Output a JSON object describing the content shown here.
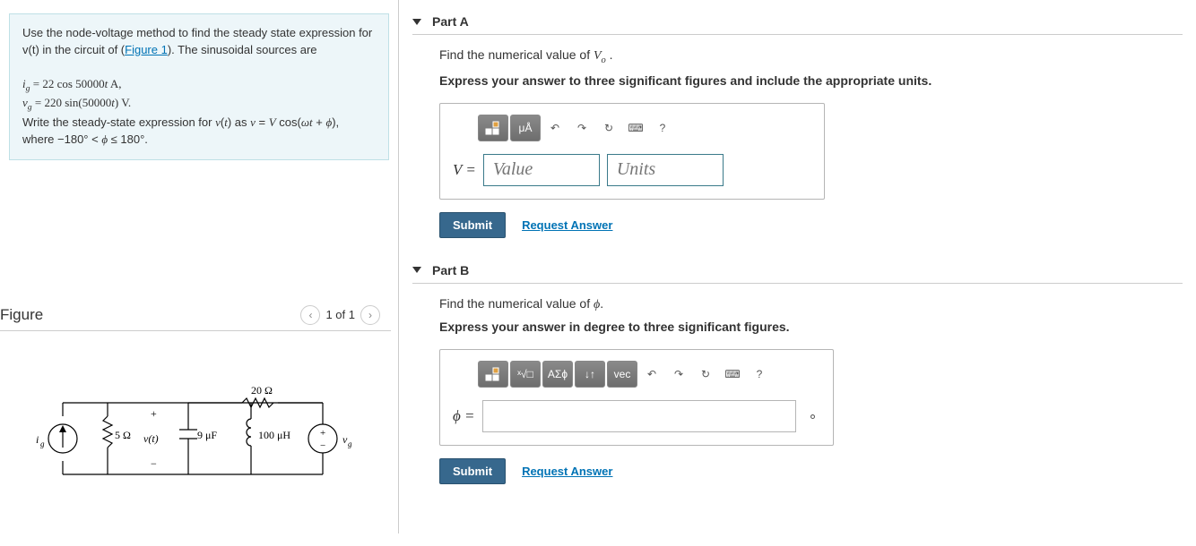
{
  "prompt": {
    "line1a": "Use the node-voltage method to find the steady state expression for v(t) in the circuit of (",
    "figure_link": "Figure 1",
    "line1b": "). The sinusoidal sources are",
    "eq_ig": "i_g = 22 cos 50000t A,",
    "eq_vg": "v_g = 220 sin(50000t) V.",
    "line4": "Write the steady-state expression for v(t) as v = V cos(ωt + ϕ),",
    "line5": "where −180° < ϕ ≤ 180°."
  },
  "figure": {
    "title": "Figure",
    "nav_text": "1 of 1",
    "labels": {
      "ig": "i_g",
      "r1": "5 Ω",
      "vt": "v(t)",
      "c": "9 μF",
      "r2": "20 Ω",
      "l": "100 μH",
      "vg": "v_g"
    }
  },
  "partA": {
    "name": "Part A",
    "instr": "Find the numerical value of V_o .",
    "hint": "Express your answer to three significant figures and include the appropriate units.",
    "toolbar": {
      "tmpl": "□",
      "units": "μÅ",
      "undo": "↶",
      "redo": "↷",
      "reset": "↻",
      "kbd": "⌨",
      "help": "?"
    },
    "varlabel": "V =",
    "value_ph": "Value",
    "units_ph": "Units",
    "submit": "Submit",
    "request": "Request Answer"
  },
  "partB": {
    "name": "Part B",
    "instr": "Find the numerical value of ϕ.",
    "hint": "Express your answer in degree to three significant figures.",
    "toolbar": {
      "tmpl": "□",
      "root": "ˣ√□",
      "greek": "ΑΣϕ",
      "arrows": "↓↑",
      "vec": "vec",
      "undo": "↶",
      "redo": "↷",
      "reset": "↻",
      "kbd": "⌨",
      "help": "?"
    },
    "varlabel": "ϕ =",
    "degree": "∘",
    "submit": "Submit",
    "request": "Request Answer"
  }
}
